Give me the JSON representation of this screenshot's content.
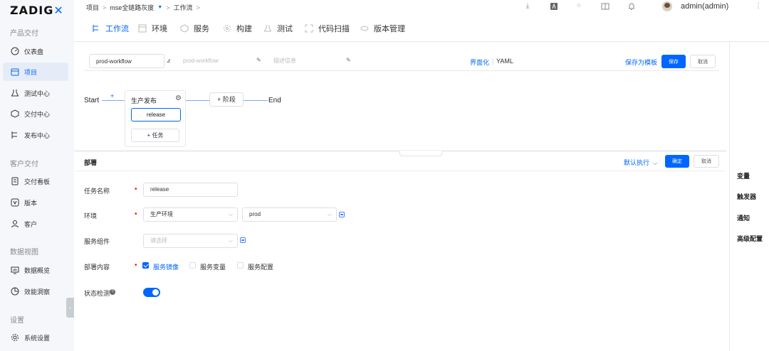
{
  "brand": {
    "logo_text": "ZADIG",
    "logo_mark": "✕"
  },
  "sidebar": {
    "sections": [
      {
        "label": "产品交付",
        "items": [
          {
            "label": "仪表盘",
            "icon": "dashboard-icon"
          },
          {
            "label": "项目",
            "icon": "project-icon",
            "active": true
          },
          {
            "label": "测试中心",
            "icon": "test-center-icon"
          },
          {
            "label": "交付中心",
            "icon": "delivery-center-icon"
          },
          {
            "label": "发布中心",
            "icon": "release-center-icon"
          }
        ]
      },
      {
        "label": "客户交付",
        "items": [
          {
            "label": "交付看板",
            "icon": "delivery-board-icon"
          },
          {
            "label": "版本",
            "icon": "version-icon"
          },
          {
            "label": "客户",
            "icon": "customer-icon"
          }
        ]
      },
      {
        "label": "数据视图",
        "items": [
          {
            "label": "数据概览",
            "icon": "data-overview-icon"
          },
          {
            "label": "效能洞察",
            "icon": "insight-icon"
          }
        ]
      },
      {
        "label": "设置",
        "items": [
          {
            "label": "系统设置",
            "icon": "system-settings-icon"
          }
        ]
      }
    ],
    "collapse_glyph": "‹"
  },
  "header": {
    "breadcrumb": [
      "项目",
      "mse全链路灰度",
      "工作流"
    ],
    "breadcrumb_sep": ">",
    "user": "admin(admin)"
  },
  "tabs": [
    {
      "label": "工作流",
      "icon": "workflow-icon",
      "active": true
    },
    {
      "label": "环境",
      "icon": "environment-icon"
    },
    {
      "label": "服务",
      "icon": "service-icon"
    },
    {
      "label": "构建",
      "icon": "build-icon"
    },
    {
      "label": "测试",
      "icon": "test-icon"
    },
    {
      "label": "代码扫描",
      "icon": "code-scan-icon"
    },
    {
      "label": "版本管理",
      "icon": "version-manage-icon"
    }
  ],
  "workflow_bar": {
    "name_value": "prod-workflow",
    "identifier_placeholder": "prod-workflow",
    "description_placeholder": "描述信息",
    "ui_mode": "界面化",
    "yaml_mode": "YAML",
    "save_template": "保存为模板",
    "save": "保存",
    "cancel": "取消"
  },
  "flow": {
    "start": "Start",
    "end": "End",
    "plus": "+",
    "stage_name": "生产发布",
    "job_name": "release",
    "add_task": "+ 任务",
    "add_stage": "+ 阶段"
  },
  "deploy": {
    "title": "部署",
    "default_run": "默认执行",
    "confirm": "确定",
    "cancel": "取消",
    "task_name_label": "任务名称",
    "task_name_value": "release",
    "env_label": "环境",
    "env_type_value": "生产环境",
    "env_value": "prod",
    "service_label": "服务组件",
    "service_placeholder": "请选择",
    "content_label": "部署内容",
    "content_options": [
      {
        "label": "服务镜像",
        "checked": true
      },
      {
        "label": "服务变量",
        "checked": false
      },
      {
        "label": "服务配置",
        "checked": false
      }
    ],
    "status_check_label": "状态检测",
    "status_check_on": true
  },
  "right_panel": [
    "变量",
    "触发器",
    "通知",
    "高级配置"
  ]
}
